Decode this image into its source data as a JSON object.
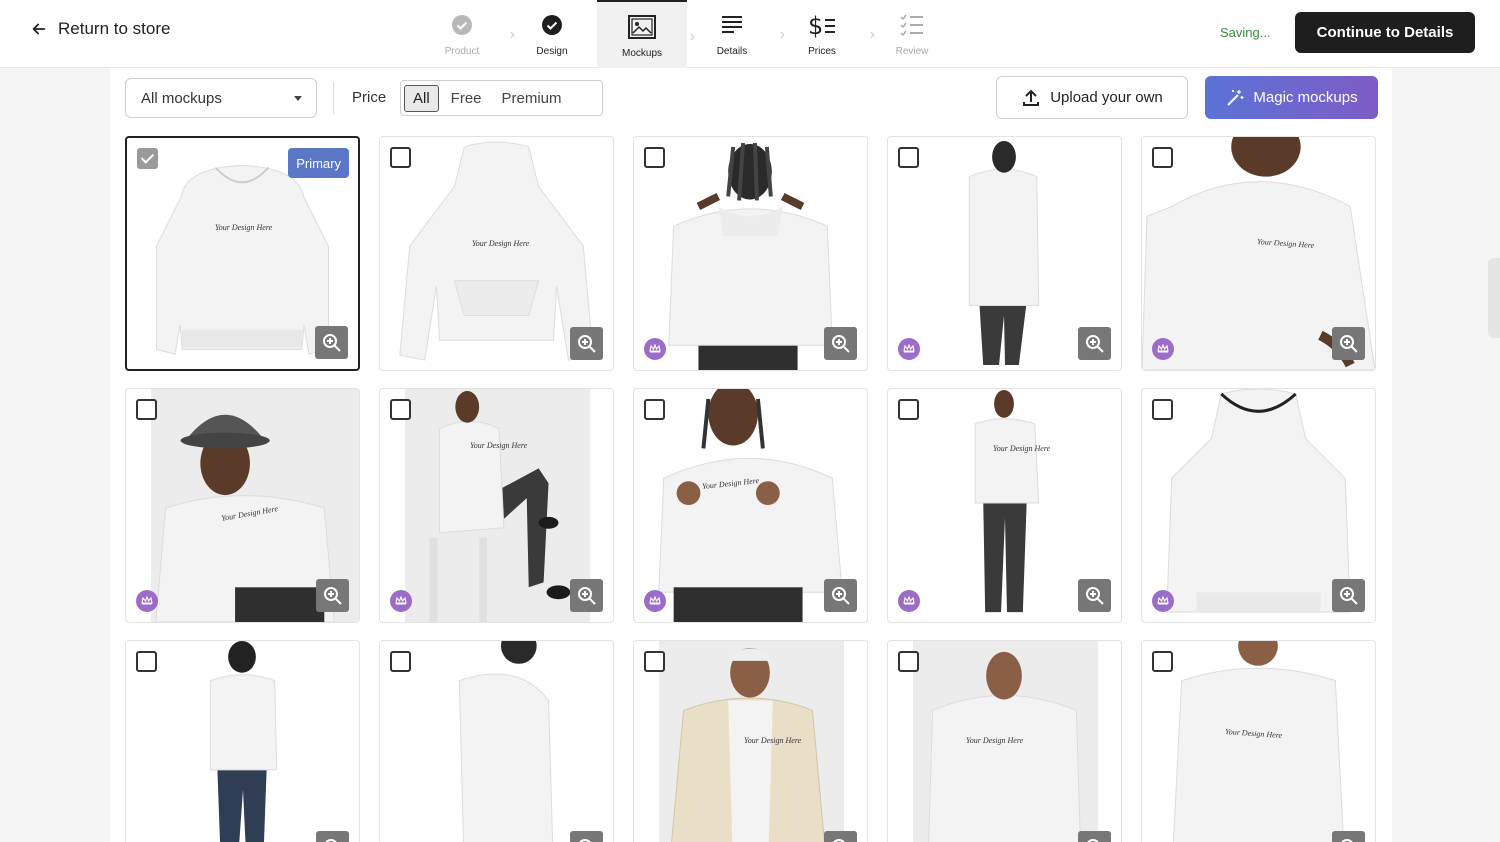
{
  "header": {
    "return_label": "Return to store",
    "saving_text": "Saving...",
    "continue_label": "Continue to Details",
    "steps": [
      {
        "label": "Product",
        "icon": "check-circle-icon",
        "state": "disabled"
      },
      {
        "label": "Design",
        "icon": "check-circle-icon",
        "state": "done"
      },
      {
        "label": "Mockups",
        "icon": "image-icon",
        "state": "active"
      },
      {
        "label": "Details",
        "icon": "text-lines-icon",
        "state": "normal"
      },
      {
        "label": "Prices",
        "icon": "dollar-list-icon",
        "state": "normal"
      },
      {
        "label": "Review",
        "icon": "checklist-icon",
        "state": "disabled"
      }
    ]
  },
  "toolbar": {
    "mockup_select": "All mockups",
    "price_label": "Price",
    "price_options": [
      "All",
      "Free",
      "Premium"
    ],
    "price_selected": "All",
    "upload_label": "Upload your own",
    "magic_label": "Magic mockups"
  },
  "primary_badge": "Primary",
  "design_text": "Your Design Here",
  "colors": {
    "accent_green": "#3b8a3b",
    "primary_badge": "#5b78c7",
    "premium_crown": "#9b6cc8",
    "magic_gradient_start": "#5b73d6",
    "magic_gradient_end": "#7e5cc6"
  },
  "mockups": [
    {
      "id": 1,
      "selected": true,
      "primary": true,
      "premium": false,
      "scene": "flat-front"
    },
    {
      "id": 2,
      "selected": false,
      "primary": false,
      "premium": false,
      "scene": "flat-front-2"
    },
    {
      "id": 3,
      "selected": false,
      "primary": false,
      "premium": true,
      "scene": "model-back"
    },
    {
      "id": 4,
      "selected": false,
      "primary": false,
      "premium": true,
      "scene": "model-back-full"
    },
    {
      "id": 5,
      "selected": false,
      "primary": false,
      "premium": true,
      "scene": "model-front-close"
    },
    {
      "id": 6,
      "selected": false,
      "primary": false,
      "premium": true,
      "scene": "model-bucket-hat"
    },
    {
      "id": 7,
      "selected": false,
      "primary": false,
      "premium": true,
      "scene": "model-seated"
    },
    {
      "id": 8,
      "selected": false,
      "primary": false,
      "premium": true,
      "scene": "model-thumbs"
    },
    {
      "id": 9,
      "selected": false,
      "primary": false,
      "premium": true,
      "scene": "model-standing"
    },
    {
      "id": 10,
      "selected": false,
      "primary": false,
      "premium": true,
      "scene": "flat-back"
    },
    {
      "id": 11,
      "selected": false,
      "primary": false,
      "premium": true,
      "scene": "model-back-jeans"
    },
    {
      "id": 12,
      "selected": false,
      "primary": false,
      "premium": true,
      "scene": "model-side"
    },
    {
      "id": 13,
      "selected": false,
      "primary": false,
      "premium": true,
      "scene": "model-jacket"
    },
    {
      "id": 14,
      "selected": false,
      "primary": false,
      "premium": true,
      "scene": "model-hood-up"
    },
    {
      "id": 15,
      "selected": false,
      "primary": false,
      "premium": true,
      "scene": "model-front-crop"
    }
  ]
}
